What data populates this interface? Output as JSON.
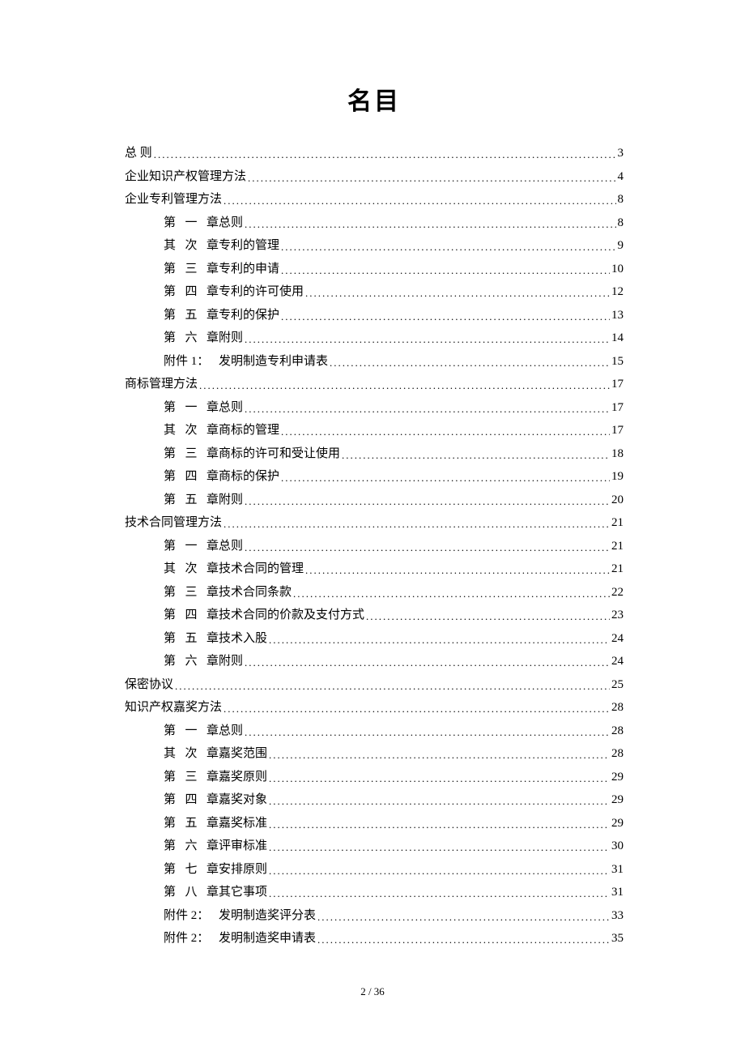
{
  "title": "名目",
  "footer": "2 / 36",
  "toc": [
    {
      "level": 0,
      "chapter": "",
      "title": "总 则",
      "page": "3"
    },
    {
      "level": 0,
      "chapter": "",
      "title": "企业知识产权管理方法",
      "page": "4"
    },
    {
      "level": 0,
      "chapter": "",
      "title": "企业专利管理方法",
      "page": "8"
    },
    {
      "level": 1,
      "chapter": "第一章",
      "title": "总则",
      "page": "8"
    },
    {
      "level": 1,
      "chapter": "其次章",
      "title": "专利的管理",
      "page": "9"
    },
    {
      "level": 1,
      "chapter": "第三章",
      "title": "专利的申请",
      "page": "10"
    },
    {
      "level": 1,
      "chapter": "第四章",
      "title": "专利的许可使用",
      "page": "12"
    },
    {
      "level": 1,
      "chapter": "第五章",
      "title": "专利的保护",
      "page": "13"
    },
    {
      "level": 1,
      "chapter": "第六章",
      "title": "附则",
      "page": "14"
    },
    {
      "level": 1,
      "chapter": "附件 1：",
      "wide": true,
      "title": "发明制造专利申请表",
      "page": "15"
    },
    {
      "level": 0,
      "chapter": "",
      "title": "商标管理方法",
      "page": "17"
    },
    {
      "level": 1,
      "chapter": "第一章",
      "title": "总则",
      "page": "17"
    },
    {
      "level": 1,
      "chapter": "其次章",
      "title": "商标的管理",
      "page": "17"
    },
    {
      "level": 1,
      "chapter": "第三章",
      "title": "商标的许可和受让使用",
      "page": "18"
    },
    {
      "level": 1,
      "chapter": "第四章",
      "title": "商标的保护",
      "page": "19"
    },
    {
      "level": 1,
      "chapter": "第五章",
      "title": "附则",
      "page": "20"
    },
    {
      "level": 0,
      "chapter": "",
      "title": "技术合同管理方法",
      "page": "21"
    },
    {
      "level": 1,
      "chapter": "第一章",
      "title": "总则",
      "page": "21"
    },
    {
      "level": 1,
      "chapter": "其次章",
      "title": "技术合同的管理",
      "page": "21"
    },
    {
      "level": 1,
      "chapter": "第三章",
      "title": "技术合同条款",
      "page": "22"
    },
    {
      "level": 1,
      "chapter": "第四章",
      "title": "技术合同的价款及支付方式",
      "page": "23"
    },
    {
      "level": 1,
      "chapter": "第五章",
      "title": "技术入股",
      "page": "24"
    },
    {
      "level": 1,
      "chapter": "第六章",
      "title": "附则",
      "page": "24"
    },
    {
      "level": 0,
      "chapter": "",
      "title": "保密协议",
      "page": "25"
    },
    {
      "level": 0,
      "chapter": "",
      "title": "知识产权嘉奖方法",
      "page": "28"
    },
    {
      "level": 1,
      "chapter": "第一章",
      "title": "总则",
      "page": "28"
    },
    {
      "level": 1,
      "chapter": "其次章",
      "title": "嘉奖范围",
      "page": "28"
    },
    {
      "level": 1,
      "chapter": "第三章",
      "title": "嘉奖原则",
      "page": "29"
    },
    {
      "level": 1,
      "chapter": "第四章",
      "title": "嘉奖对象",
      "page": "29"
    },
    {
      "level": 1,
      "chapter": "第五章",
      "title": "嘉奖标准",
      "page": "29"
    },
    {
      "level": 1,
      "chapter": "第六章",
      "title": "评审标准",
      "page": "30"
    },
    {
      "level": 1,
      "chapter": "第七章",
      "title": "安排原则",
      "page": "31"
    },
    {
      "level": 1,
      "chapter": "第八章",
      "title": "其它事项",
      "page": "31"
    },
    {
      "level": 1,
      "chapter": "附件 2：",
      "wide": true,
      "title": "发明制造奖评分表",
      "page": "33"
    },
    {
      "level": 1,
      "chapter": "附件 2：",
      "wide": true,
      "title": "发明制造奖申请表",
      "page": "35"
    }
  ]
}
